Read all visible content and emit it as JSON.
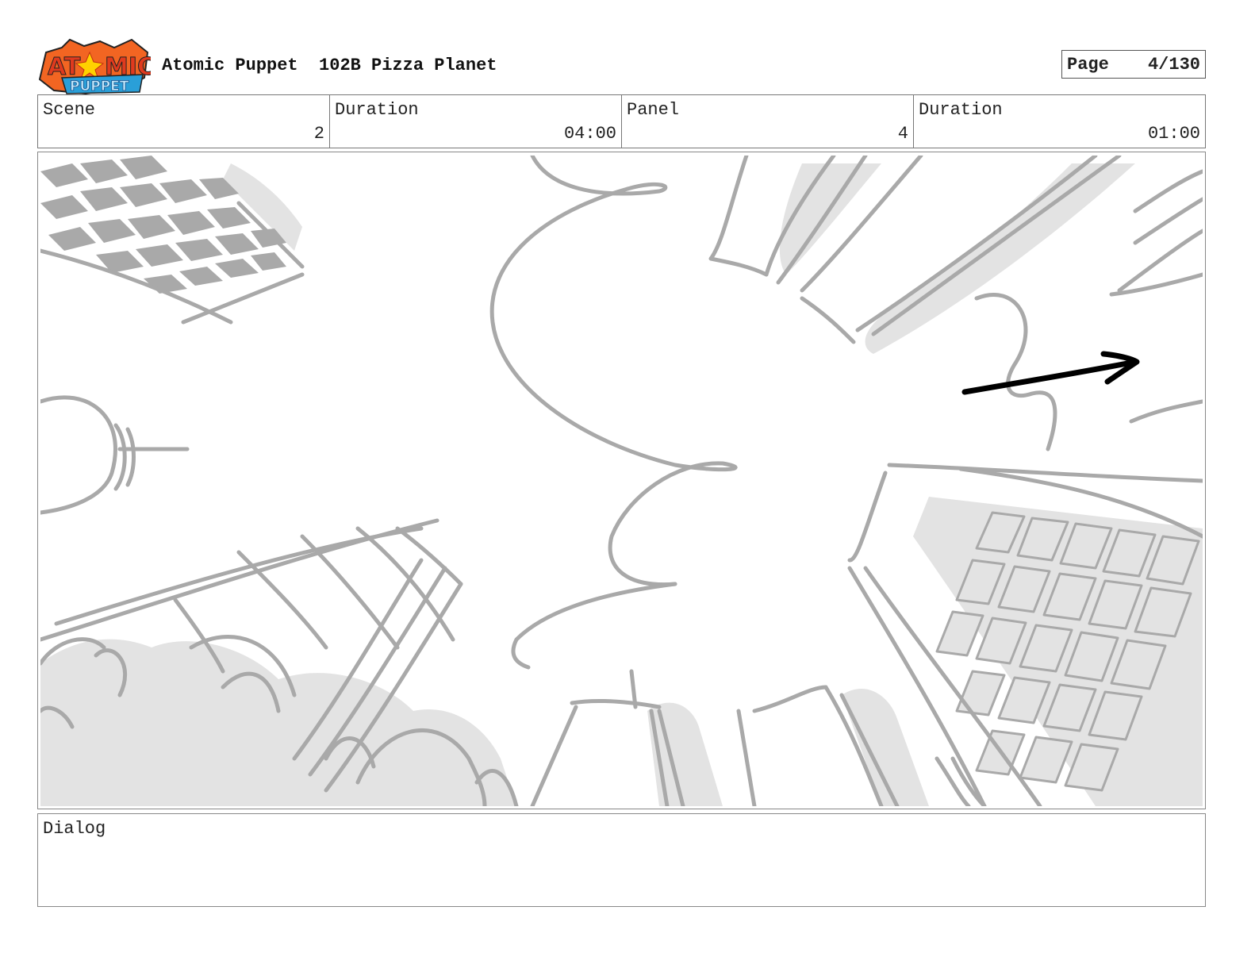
{
  "header": {
    "logo_text_top": "ATOMIC",
    "logo_text_bottom": "PUPPET",
    "show_title": "Atomic Puppet",
    "episode_title": "102B Pizza Planet",
    "page_label": "Page",
    "page_value": "4/130"
  },
  "info": {
    "scene_label": "Scene",
    "scene_value": "2",
    "scene_duration_label": "Duration",
    "scene_duration_value": "04:00",
    "panel_label": "Panel",
    "panel_value": "4",
    "panel_duration_label": "Duration",
    "panel_duration_value": "01:00"
  },
  "panel": {
    "sketch_color": "#a9a9a9",
    "shade_color": "#e3e3e3",
    "arrow_color": "#000000"
  },
  "dialog": {
    "label": "Dialog",
    "text": ""
  }
}
